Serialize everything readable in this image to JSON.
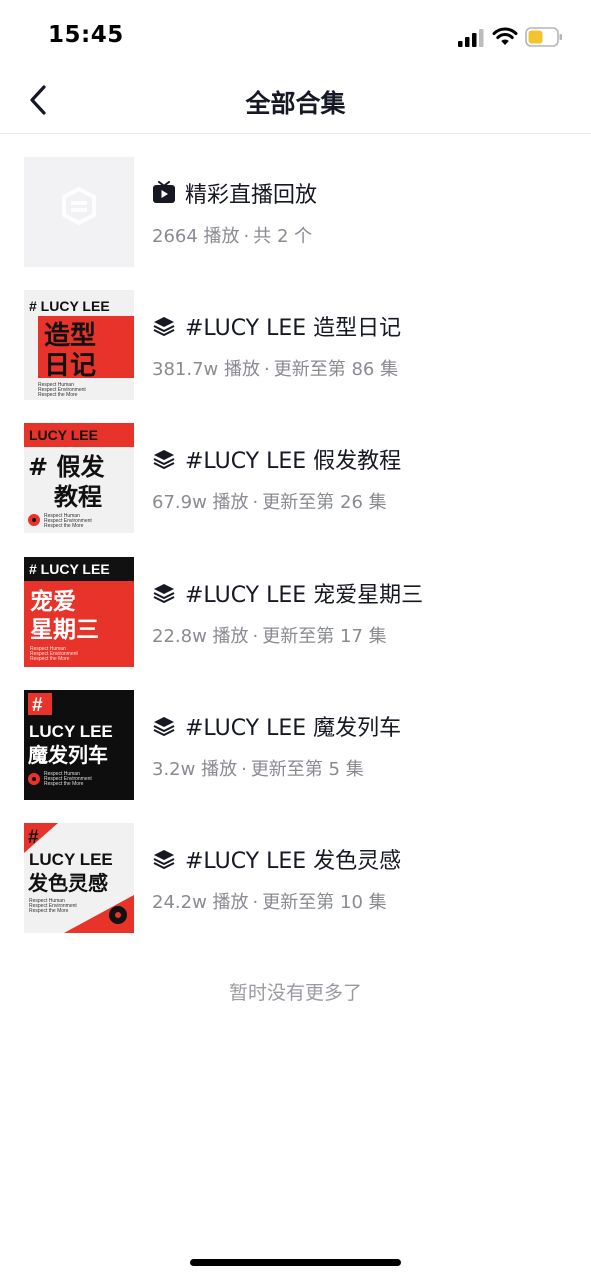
{
  "status_bar": {
    "time": "15:45",
    "icons": [
      "signal-icon",
      "wifi-icon",
      "battery-icon"
    ]
  },
  "nav": {
    "title": "全部合集",
    "back_icon": "chevron-left-icon"
  },
  "collections": [
    {
      "icon": "live-replay-icon",
      "title": "精彩直播回放",
      "plays": "2664 播放",
      "separator": "·",
      "progress": "共 2 个"
    },
    {
      "icon": "stack-icon",
      "title": "#LUCY LEE 造型日记",
      "plays": "381.7w 播放",
      "separator": "·",
      "progress": "更新至第 86 集",
      "cover": {
        "brand": "# LUCY LEE",
        "line1": "造型",
        "line2": "日记",
        "taglines": [
          "Respect Human",
          "Respect Environment",
          "Respect the More"
        ]
      }
    },
    {
      "icon": "stack-icon",
      "title": "#LUCY LEE 假发教程",
      "plays": "67.9w 播放",
      "separator": "·",
      "progress": "更新至第 26 集",
      "cover": {
        "brand": "LUCY LEE",
        "line1": "# 假发",
        "line2": "教程",
        "taglines": [
          "Respect Human",
          "Respect Environment",
          "Respect the More"
        ]
      }
    },
    {
      "icon": "stack-icon",
      "title": "#LUCY LEE 宠爱星期三",
      "plays": "22.8w 播放",
      "separator": "·",
      "progress": "更新至第 17 集",
      "cover": {
        "brand": "# LUCY LEE",
        "line1": "宠爱",
        "line2": "星期三",
        "taglines": [
          "Respect Human",
          "Respect Environment",
          "Respect the More"
        ]
      }
    },
    {
      "icon": "stack-icon",
      "title": "#LUCY LEE 魔发列车",
      "plays": "3.2w 播放",
      "separator": "·",
      "progress": "更新至第 5 集",
      "cover": {
        "hash": "#",
        "brand": "LUCY LEE",
        "line1": "魔发列车",
        "taglines": [
          "Respect Human",
          "Respect Environment",
          "Respect the More"
        ]
      }
    },
    {
      "icon": "stack-icon",
      "title": "#LUCY LEE 发色灵感",
      "plays": "24.2w 播放",
      "separator": "·",
      "progress": "更新至第 10 集",
      "cover": {
        "hash": "#",
        "brand": "LUCY LEE",
        "line1": "发色灵感",
        "taglines": [
          "Respect Human",
          "Respect Environment",
          "Respect the More"
        ]
      }
    }
  ],
  "footer": {
    "end_text": "暂时没有更多了"
  },
  "colors": {
    "brand_red": "#e8332b",
    "text_primary": "#161823",
    "text_secondary": "#8a8b91"
  }
}
